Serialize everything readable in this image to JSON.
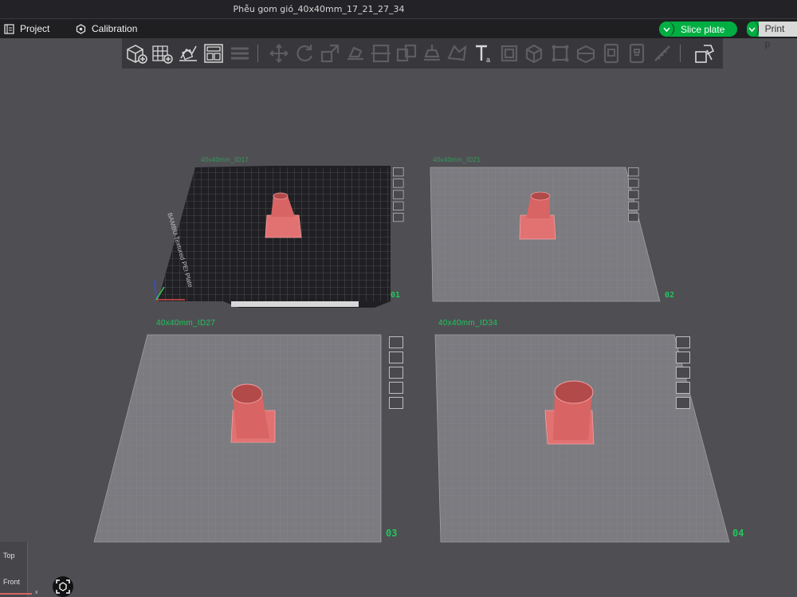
{
  "window": {
    "title": "Phễu gom gió_40x40mm_17_21_27_34"
  },
  "menubar": {
    "project_label": "Project",
    "calibration_label": "Calibration",
    "slice_label": "Slice plate",
    "print_label": "Print p"
  },
  "toolbar": {
    "icons": [
      "add-object-icon",
      "add-plate-icon",
      "auto-orient-icon",
      "arrange-icon",
      "layers-icon",
      "move-icon",
      "rotate-icon",
      "scale-icon",
      "lay-on-face-icon",
      "cut-icon",
      "split-objects-icon",
      "support-paint-icon",
      "seam-paint-icon",
      "measure-icon",
      "text-icon",
      "emboss-icon",
      "color-paint-icon",
      "boolean-icon",
      "mesh-boolean-icon",
      "assembly-icon",
      "variable-layer-icon",
      "assemble-icon"
    ]
  },
  "plates": [
    {
      "name": "40x40mm_ID17",
      "number": "01"
    },
    {
      "name": "40x40mm_ID21",
      "number": "02"
    },
    {
      "name": "40x40mm_ID27",
      "number": "03"
    },
    {
      "name": "40x40mm_ID34",
      "number": "04"
    }
  ],
  "plate_text": {
    "texture_brand": "BAMBU Textured PEI Plate"
  },
  "viewcube": {
    "top": "Top",
    "front": "Front",
    "axis_x": "x"
  },
  "colors": {
    "accent": "#00ae42",
    "plate_label": "#21c55d",
    "model": "#e27272"
  }
}
